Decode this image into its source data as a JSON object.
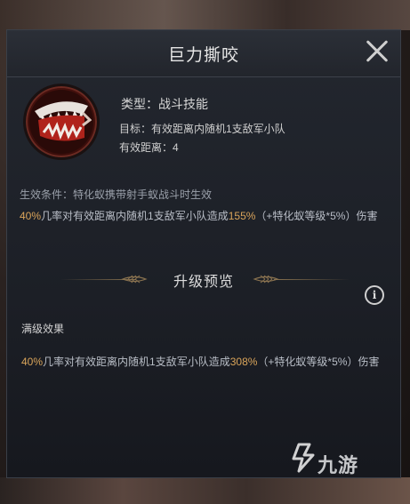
{
  "dialog": {
    "title": "巨力撕咬",
    "close_icon": "close-icon"
  },
  "skill": {
    "icon": "jaws-bite-icon",
    "type_label": "类型：战斗技能",
    "target_label": "目标：有效距离内随机1支敌军小队",
    "range_label": "有效距离：4"
  },
  "effect": {
    "condition": "生效条件：特化蚁携带射手蚁战斗时生效",
    "desc_prefix": "40%",
    "desc_mid1": "几率对有效距离内随机1支敌军小队造成",
    "desc_value": "155%",
    "desc_mid2": "（+特化蚁等级*5%）",
    "desc_suffix": "伤害"
  },
  "upgrade": {
    "title": "升级预览",
    "info_icon": "info-icon",
    "max_label": "满级效果",
    "desc_prefix": "40%",
    "desc_mid1": "几率对有效距离内随机1支敌军小队造成",
    "desc_value": "308%",
    "desc_mid2": "（+特化蚁等级*5%）",
    "desc_suffix": "伤害"
  },
  "watermark": {
    "text": "九游",
    "logo_icon": "jiuyou-logo-icon"
  },
  "colors": {
    "accent_orange": "#d9a45a",
    "panel_bg": "#1f2229"
  }
}
